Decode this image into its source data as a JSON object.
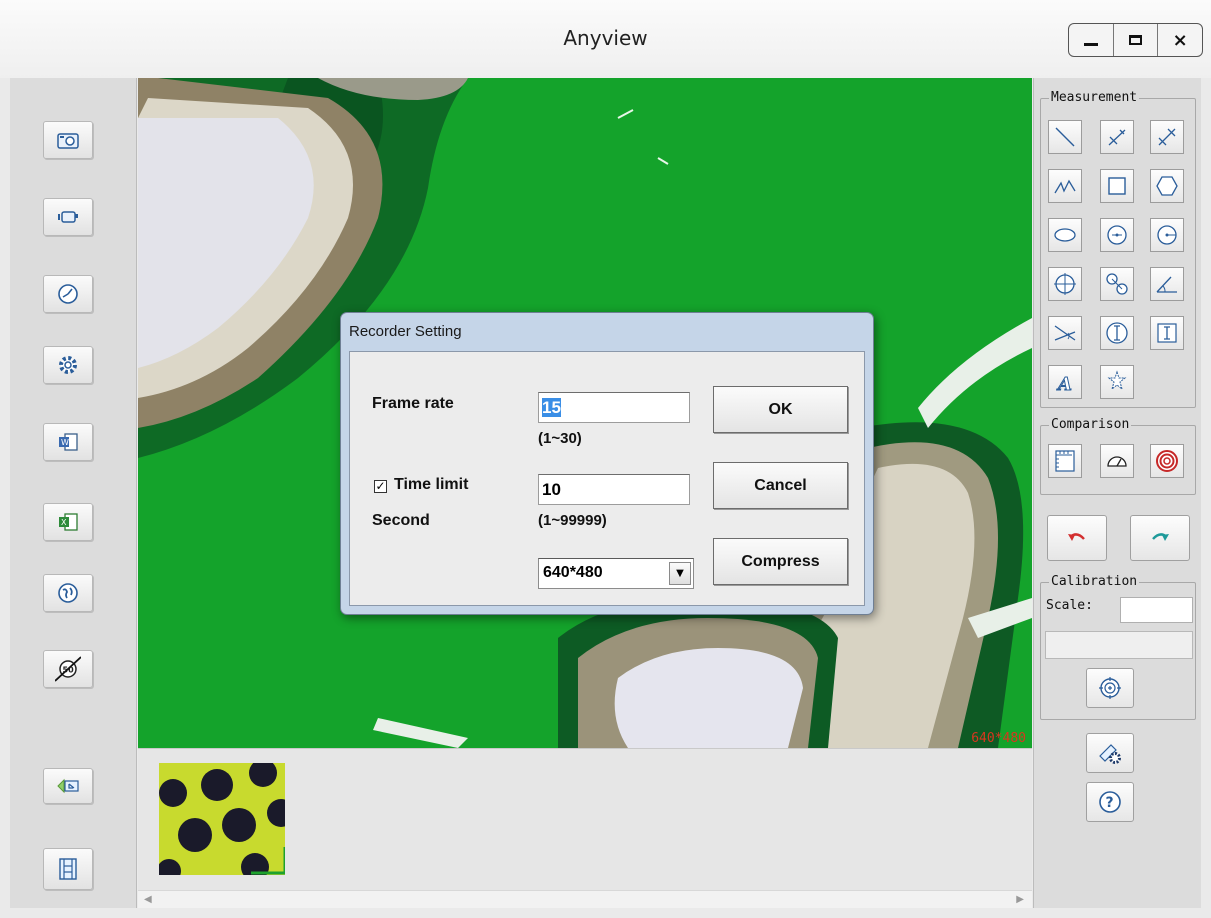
{
  "window": {
    "title": "Anyview",
    "controls": {
      "minimize": "minimize",
      "maximize": "maximize",
      "close": "×"
    }
  },
  "left_toolbar": {
    "buttons": [
      {
        "name": "snapshot-button",
        "icon": "camera-icon"
      },
      {
        "name": "record-button",
        "icon": "video-camera-icon"
      },
      {
        "name": "timer-button",
        "icon": "clock-icon"
      },
      {
        "name": "settings-button",
        "icon": "gear-icon"
      },
      {
        "name": "export-word-button",
        "icon": "word-doc-icon"
      },
      {
        "name": "export-excel-button",
        "icon": "excel-doc-icon"
      },
      {
        "name": "language-button",
        "icon": "globe-icon"
      },
      {
        "name": "disable-50hz-button",
        "icon": "50-disabled-icon"
      }
    ],
    "bottom_buttons": [
      {
        "name": "import-button",
        "icon": "import-arrow-icon"
      },
      {
        "name": "film-button",
        "icon": "film-strip-icon"
      }
    ]
  },
  "video": {
    "resolution_overlay": "640*480"
  },
  "dialog": {
    "title": "Recorder Setting",
    "frame_rate_label": "Frame rate",
    "frame_rate_value": "15",
    "frame_rate_range": "(1~30)",
    "time_limit_label": "Time limit",
    "time_limit_checked": "✓",
    "time_limit_value": "10",
    "second_label": "Second",
    "time_limit_range": "(1~99999)",
    "resolution_value": "640*480",
    "dropdown_arrow": "▼",
    "ok_label": "OK",
    "cancel_label": "Cancel",
    "compress_label": "Compress"
  },
  "right_panel": {
    "measurement_label": "Measurement",
    "comparison_label": "Comparison",
    "calibration_label": "Calibration",
    "scale_label": "Scale:",
    "scale_value": "",
    "measurement_tools": [
      "line-icon",
      "angle-line-icon",
      "dimension-line-icon",
      "polyline-icon",
      "rectangle-icon",
      "polygon-icon",
      "ellipse-icon",
      "circle-center-icon",
      "circle-radius-icon",
      "circle-crosshair-icon",
      "two-circles-icon",
      "angle-icon",
      "cross-angle-icon",
      "vertical-circle-icon",
      "text-cursor-icon",
      "text-annotation-icon",
      "auto-detect-icon"
    ],
    "comparison_tools": [
      "ruler-icon",
      "protractor-icon",
      "target-rings-icon"
    ]
  },
  "colors": {
    "video_green": "#12a12a",
    "overlay_red": "#d8361f",
    "dialog_frame": "#c5d5e8",
    "selection_blue": "#3a8ee6"
  }
}
